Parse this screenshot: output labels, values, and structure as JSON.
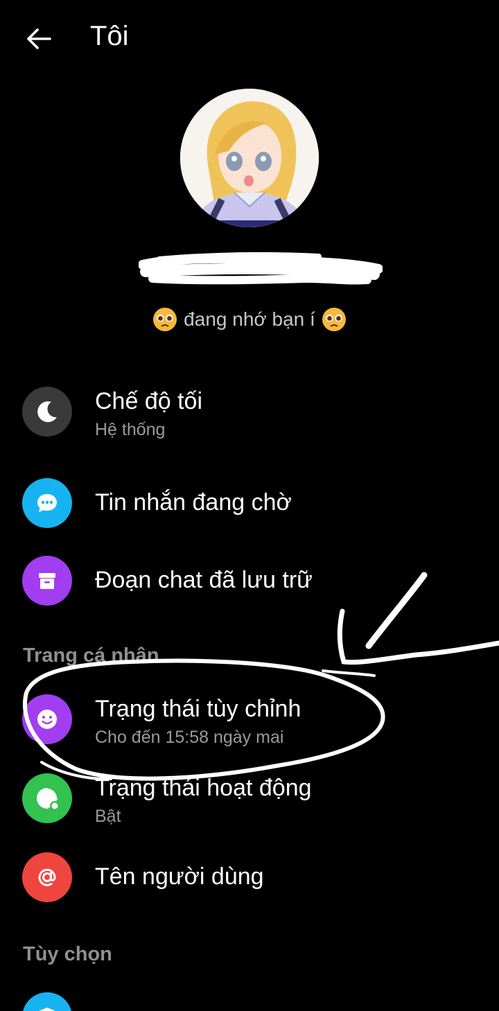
{
  "header": {
    "title": "Tôi"
  },
  "profile": {
    "status_text": "đang nhớ bạn í"
  },
  "menu": {
    "dark_mode": {
      "label": "Chế độ tối",
      "sub": "Hệ thống",
      "color": "#3a3a3a"
    },
    "pending_messages": {
      "label": "Tin nhắn đang chờ",
      "color": "#17b3f0"
    },
    "archived_chats": {
      "label": "Đoạn chat đã lưu trữ",
      "color": "#a23df0"
    }
  },
  "section_profile": {
    "title": "Trang cá nhân",
    "custom_status": {
      "label": "Trạng thái tùy chỉnh",
      "sub": "Cho đến 15:58 ngày mai",
      "color": "#a23df0"
    },
    "active_status": {
      "label": "Trạng thái hoạt động",
      "sub": "Bật",
      "color": "#31c24f"
    },
    "username": {
      "label": "Tên người dùng",
      "color": "#f0443e"
    }
  },
  "section_options": {
    "title": "Tùy chọn",
    "next_item_color": "#17b3f0"
  }
}
